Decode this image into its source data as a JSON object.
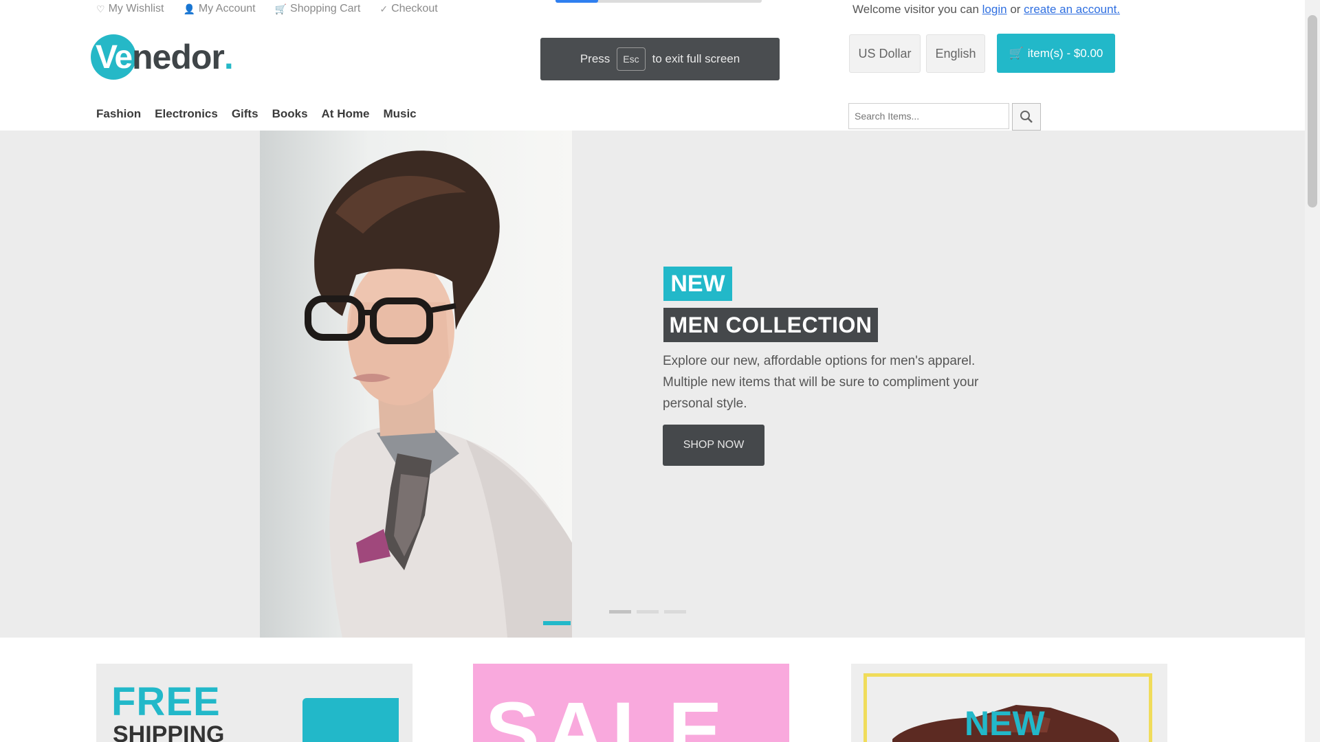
{
  "toplinks": {
    "wishlist": "My Wishlist",
    "account": "My Account",
    "cart": "Shopping Cart",
    "checkout": "Checkout"
  },
  "welcome": {
    "prefix": "Welcome visitor you can",
    "login": "login",
    "or": "or",
    "create": "create an account."
  },
  "logo": {
    "first": "Ve",
    "rest": "nedor",
    "dot": "."
  },
  "fullscreen_notice": {
    "press": "Press",
    "key": "Esc",
    "suffix": "to exit full screen"
  },
  "header": {
    "currency": "US Dollar",
    "language": "English",
    "cart_label": "item(s) - $0.00"
  },
  "nav": [
    "Fashion",
    "Electronics",
    "Gifts",
    "Books",
    "At Home",
    "Music"
  ],
  "search": {
    "placeholder": "Search Items..."
  },
  "hero": {
    "badge_new": "NEW",
    "badge_collection": "MEN COLLECTION",
    "description": "Explore our new, affordable options for men's apparel. Multiple new items that will be sure to compliment your personal style.",
    "button": "SHOP NOW",
    "slides_total": 3,
    "active_slide": 1
  },
  "banners": {
    "free": "FREE",
    "shipping": "SHIPPING",
    "sale": "SALE",
    "new": "NEW"
  },
  "colors": {
    "accent": "#22b8c9",
    "dark": "#45484b",
    "hero_bg": "#ececec",
    "sale_pink": "#f9a9dd"
  }
}
